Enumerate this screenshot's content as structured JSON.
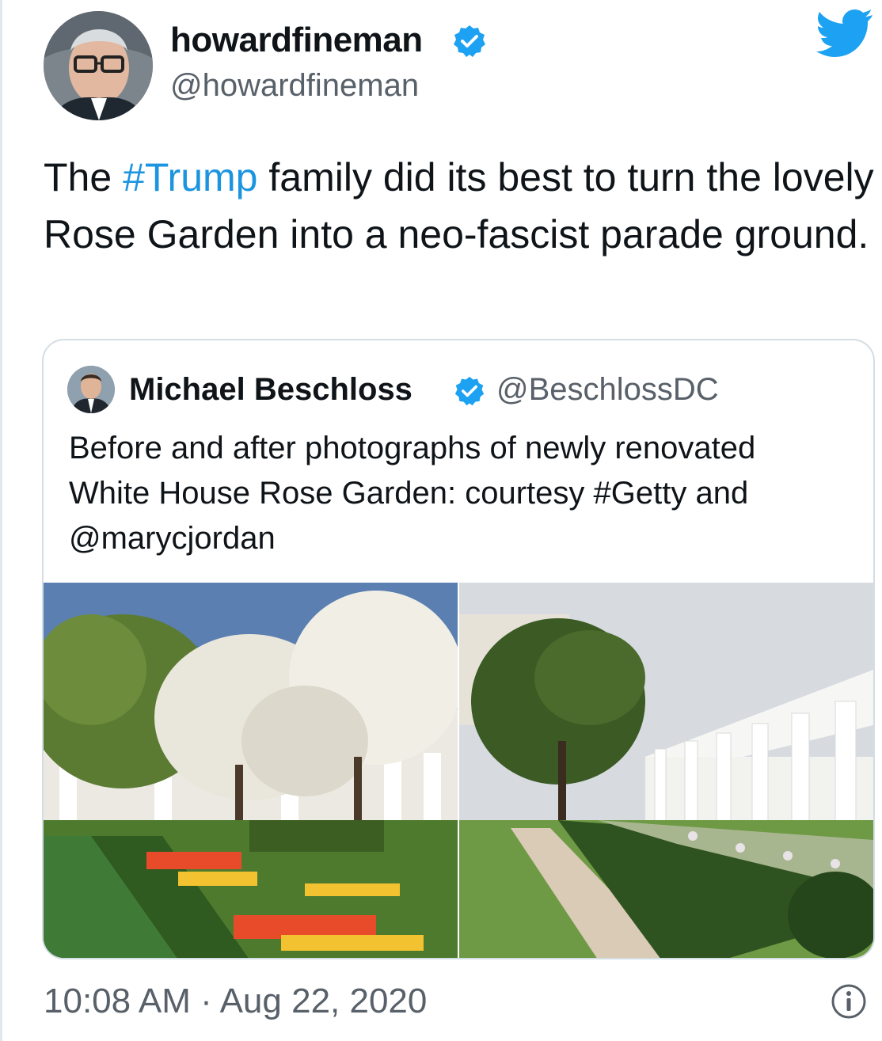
{
  "tweet": {
    "display_name": "howardfineman",
    "handle": "@howardfineman",
    "text_before": "The ",
    "hashtag": "#Trump",
    "text_after": " family did its best to turn the lovely Rose Garden into a neo-fascist parade ground.",
    "timestamp": "10:08 AM · Aug 22, 2020"
  },
  "quote": {
    "display_name": "Michael Beschloss",
    "handle": "@BeschlossDC",
    "text": "Before and after photographs of newly renovated White House Rose Garden: courtesy #Getty and @marycjordan"
  },
  "colors": {
    "accent": "#1da1f2",
    "link": "#1b95e0",
    "muted": "#586069"
  },
  "icons": {
    "verified": "verified-badge-icon",
    "twitter": "twitter-bird-icon",
    "info": "info-icon"
  }
}
